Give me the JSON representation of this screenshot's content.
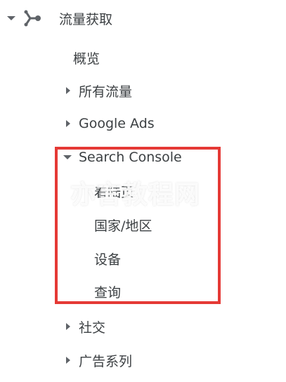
{
  "section": {
    "icon": "acquisition-icon",
    "label": "流量获取"
  },
  "items": {
    "overview": "概览",
    "all_traffic": "所有流量",
    "google_ads": "Google Ads",
    "search_console": "Search Console",
    "sc_landing": "着陆页",
    "sc_countries": "国家/地区",
    "sc_devices": "设备",
    "sc_queries": "查询",
    "social": "社交",
    "campaigns": "广告系列"
  },
  "watermark": "亦言教程网",
  "colors": {
    "highlight": "#e53935",
    "text": "#3c4043",
    "icon": "#5f6368"
  }
}
